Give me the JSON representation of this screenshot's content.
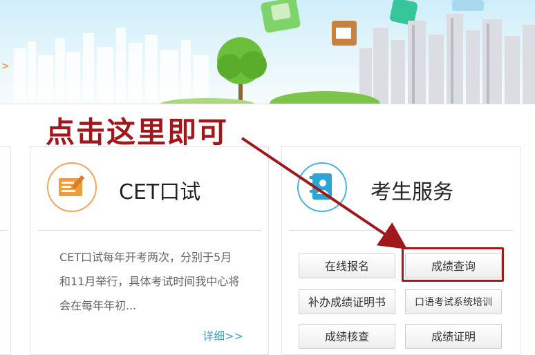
{
  "banner": {
    "arrow_glyph": ">"
  },
  "annotation": {
    "text": "点击这里即可"
  },
  "cet_card": {
    "title": "CET口试",
    "icon": "certificate-edit-icon",
    "description": "CET口试每年开考两次，分别于5月和11月举行，具体考试时间我中心将会在每年年初...",
    "detail_link": "详细>>"
  },
  "service_card": {
    "title": "考生服务",
    "icon": "notebook-person-icon",
    "buttons": [
      "在线报名",
      "成绩查询",
      "补办成绩证明书",
      "口语考试系统培训",
      "成绩核查",
      "成绩证明"
    ]
  },
  "colors": {
    "annotation_red": "#a0181c",
    "cet_icon_orange": "#f0a65a",
    "service_icon_blue": "#46b6e0",
    "link_blue": "#3aa4c8"
  }
}
